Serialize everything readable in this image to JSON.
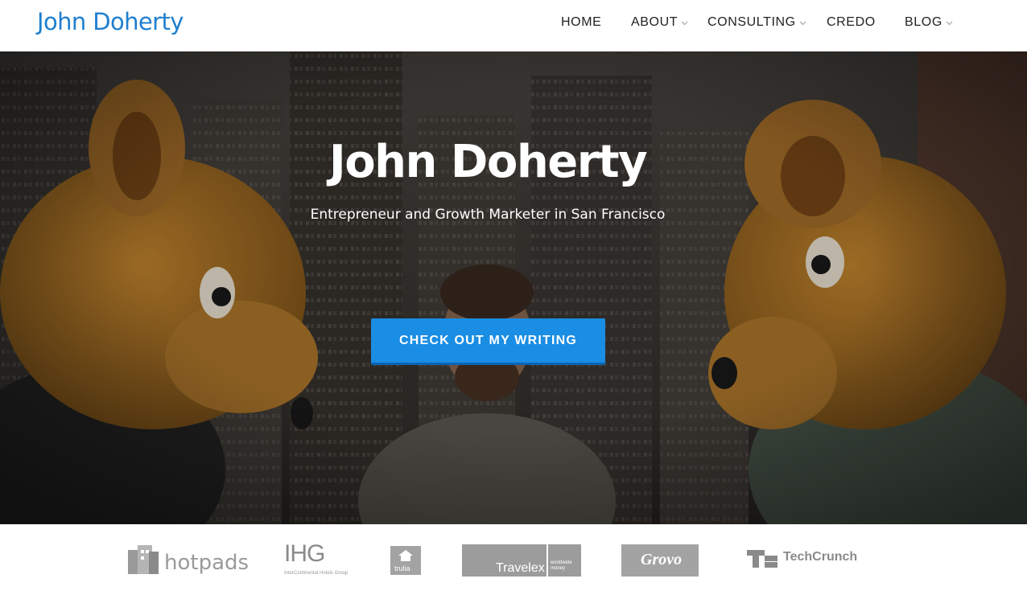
{
  "header": {
    "logo": "John Doherty",
    "nav": [
      {
        "label": "HOME",
        "has_dropdown": false
      },
      {
        "label": "ABOUT",
        "has_dropdown": true
      },
      {
        "label": "CONSULTING",
        "has_dropdown": true
      },
      {
        "label": "CREDO",
        "has_dropdown": false
      },
      {
        "label": "BLOG",
        "has_dropdown": true
      }
    ]
  },
  "hero": {
    "title": "John Doherty",
    "subtitle": "Entrepreneur and Growth Marketer in San Francisco",
    "cta_label": "CHECK OUT MY WRITING"
  },
  "clients": {
    "hotpads": "hotpads",
    "ihg": "IHG",
    "ihg_sub": "InterContinental Hotels Group",
    "trulia": "trulia",
    "travelex": "Travelex",
    "travelex_sub": "worldwide money",
    "grovo": "Grovo",
    "techcrunch": "TechCrunch"
  },
  "colors": {
    "brand": "#1f7fcf",
    "cta": "#1a8de4",
    "nav_text": "#222222"
  }
}
